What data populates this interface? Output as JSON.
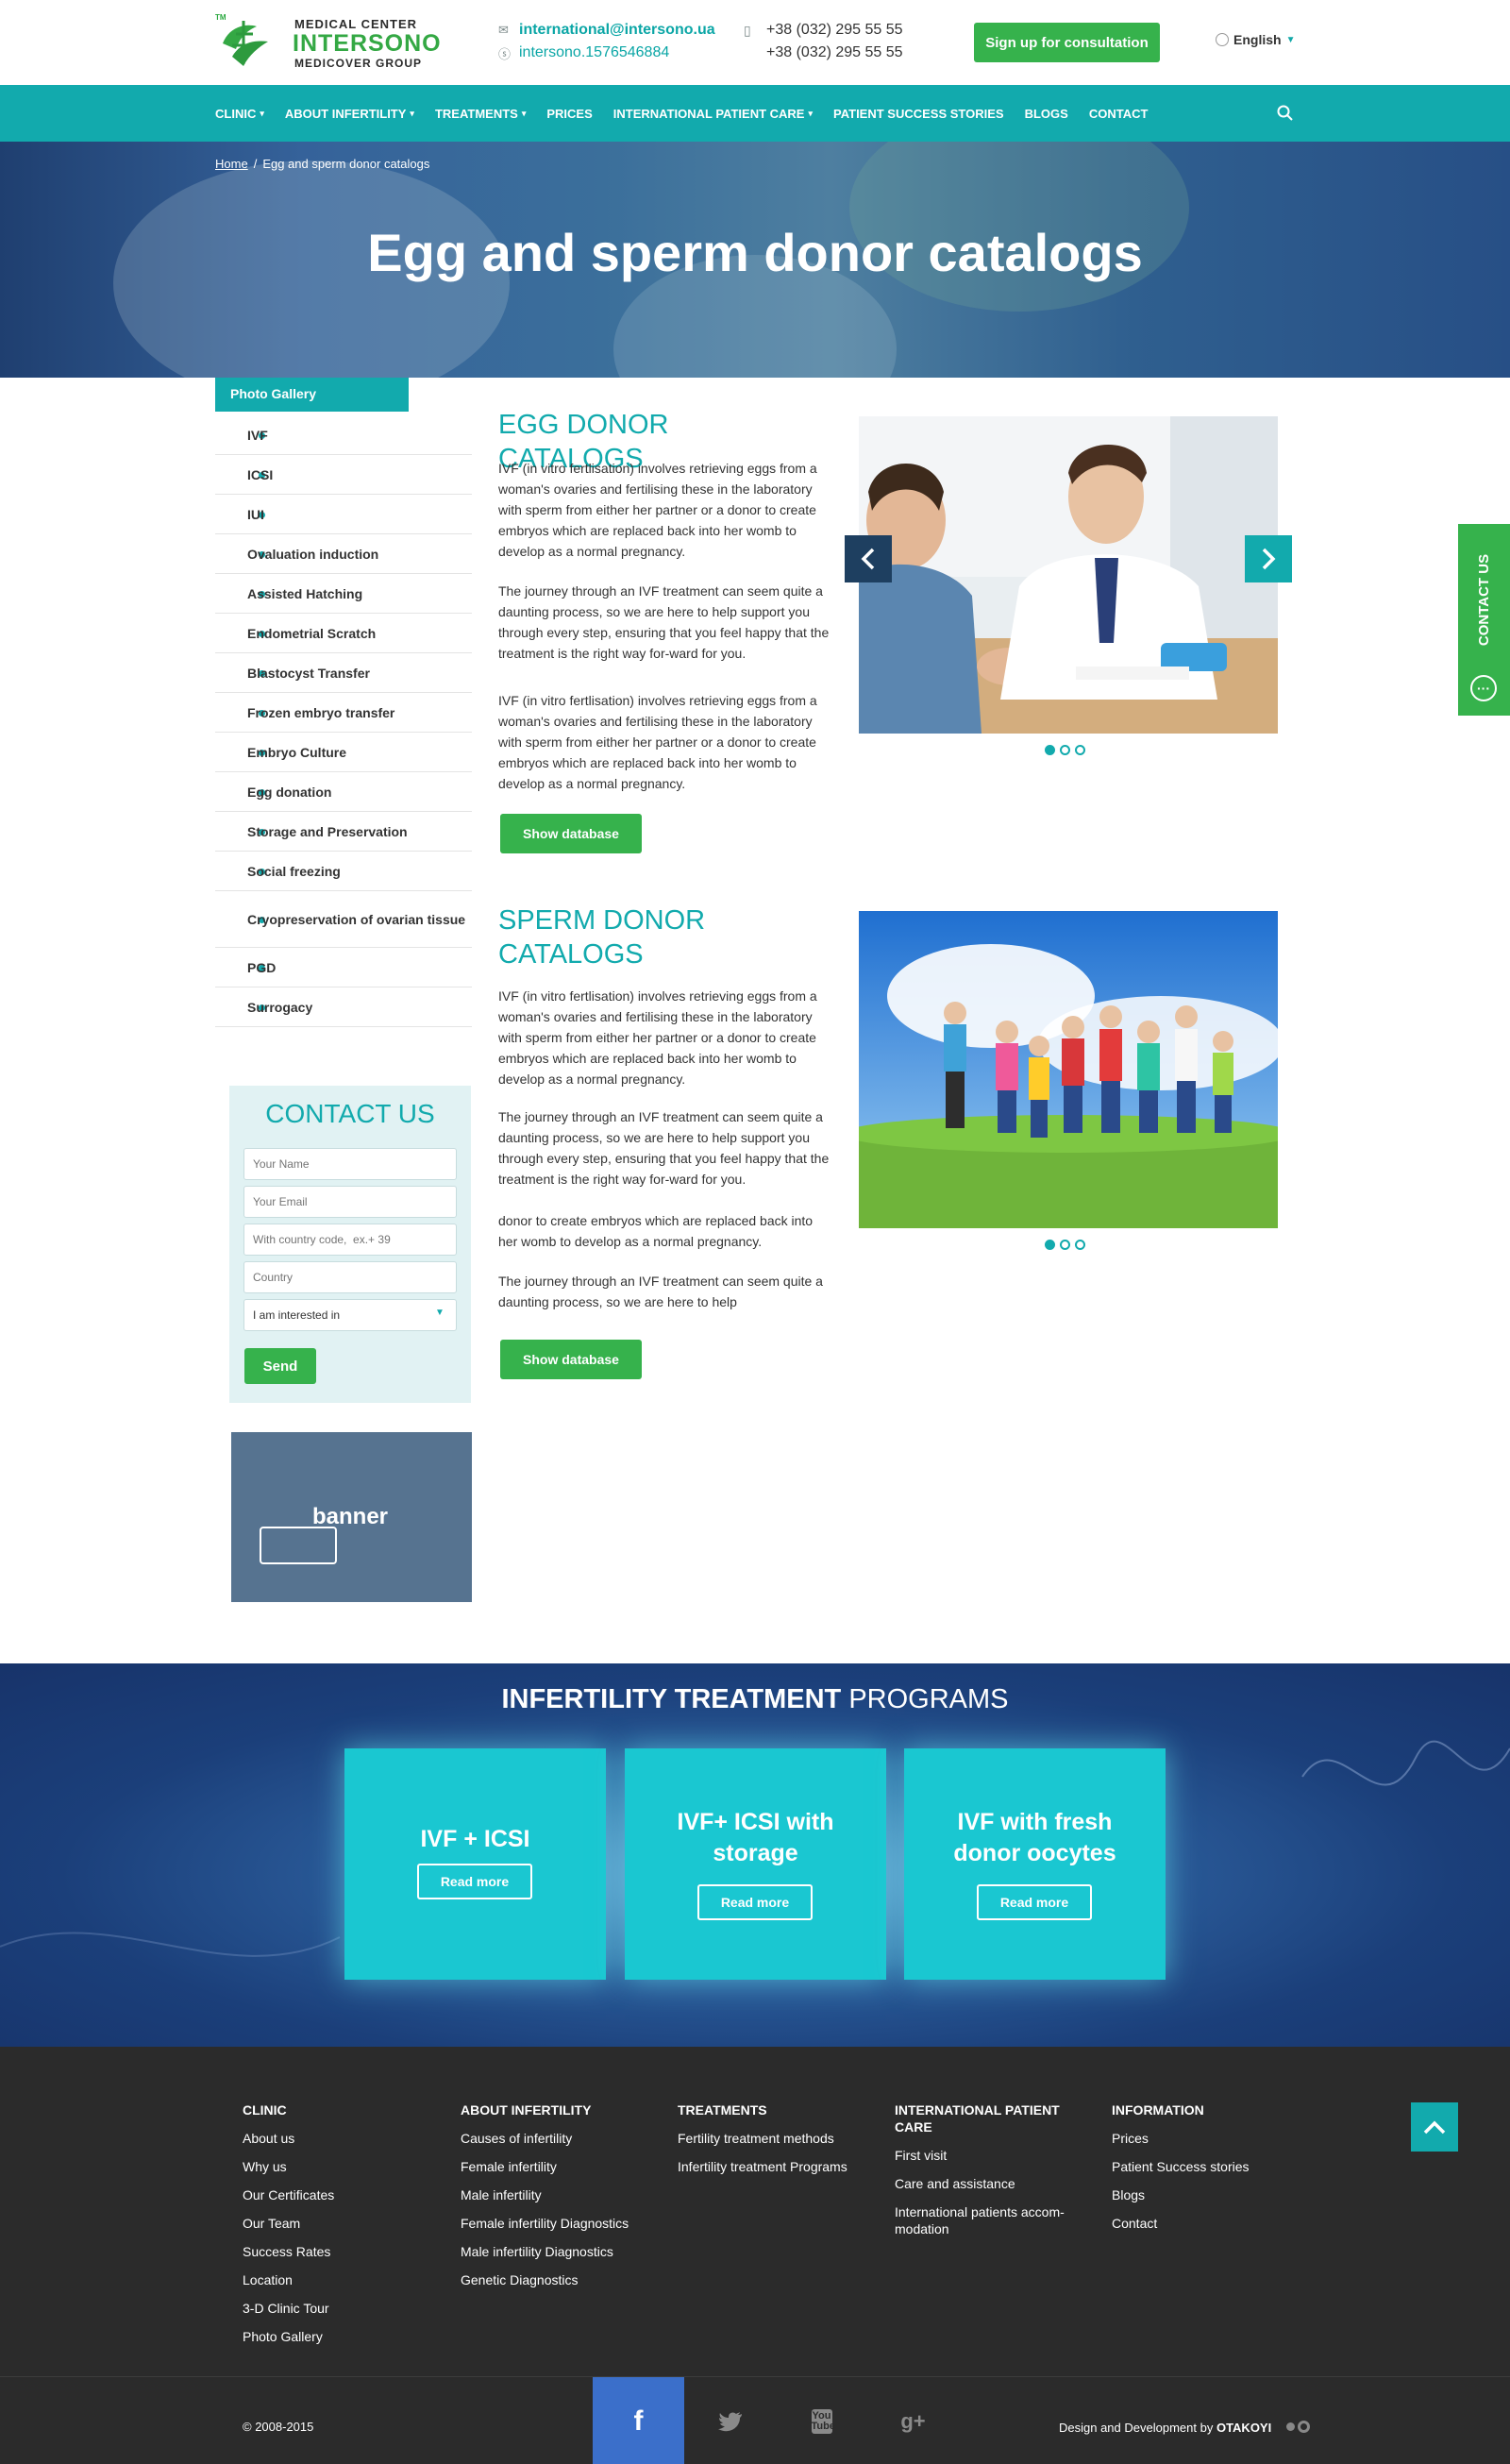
{
  "header": {
    "logo": {
      "tm": "TM",
      "line1": "MEDICAL CENTER",
      "line2": "INTERSONO",
      "line3": "MEDICOVER GROUP"
    },
    "email": "international@intersono.ua",
    "skype": "intersono.1576546884",
    "phone1": "+38 (032) 295 55 55",
    "phone2": "+38 (032) 295 55 55",
    "signup_label": "Sign up for consultation",
    "language": "English"
  },
  "nav": {
    "items": [
      {
        "label": "CLINIC",
        "dropdown": true
      },
      {
        "label": "ABOUT INFERTILITY",
        "dropdown": true
      },
      {
        "label": "TREATMENTS",
        "dropdown": true
      },
      {
        "label": "PRICES",
        "dropdown": false
      },
      {
        "label": "INTERNATIONAL PATIENT CARE",
        "dropdown": true
      },
      {
        "label": "PATIENT SUCCESS STORIES",
        "dropdown": false
      },
      {
        "label": "BLOGS",
        "dropdown": false
      },
      {
        "label": "CONTACT",
        "dropdown": false
      }
    ],
    "search_icon": "search-icon"
  },
  "hero": {
    "breadcrumb_home": "Home",
    "breadcrumb_sep": "/",
    "breadcrumb_current": "Egg and sperm donor catalogs",
    "title": "Egg and sperm donor catalogs"
  },
  "sidebar": {
    "tab": "Photo Gallery",
    "items": [
      "IVF",
      "ICSI",
      "IUI",
      "Ovaluation induction",
      "Assisted Hatching",
      "Endometrial Scratch",
      "Blastocyst Transfer",
      "Frozen embryo transfer",
      "Embryo Culture",
      "Egg donation",
      "Storage and Preservation",
      "Social freezing",
      "Cryopreservation of ovarian tissue",
      "PGD",
      "Surrogacy"
    ]
  },
  "contact_form": {
    "title": "CONTACT US",
    "name_placeholder": "Your Name",
    "email_placeholder": "Your Email",
    "phone_placeholder": "With country code,  ex.+ 39",
    "country_placeholder": "Country",
    "interest_selected": "I am interested in",
    "send_label": "Send"
  },
  "banner": {
    "text": "banner"
  },
  "egg_section": {
    "title": "EGG DONOR CATALOGS",
    "p1": "IVF (in vitro fertlisation) involves retrieving eggs from a woman's ovaries and fertilising these in the laboratory with sperm from either her partner or a donor to create embryos which are replaced back into her womb to develop as a normal pregnancy.",
    "p2": "The journey through an IVF treatment can seem quite a daunting process, so we are here to help support you through every step, ensuring that you feel happy that the treatment is the right way for-ward for you.",
    "p3": "IVF (in vitro fertlisation) involves retrieving eggs from a woman's ovaries and fertilising these in the laboratory with sperm from either her partner or a donor to create embryos which are replaced back into her womb to develop as a normal pregnancy.",
    "button": "Show database"
  },
  "sperm_section": {
    "title": "SPERM DONOR CATALOGS",
    "p1": "IVF (in vitro fertlisation) involves retrieving eggs from a woman's ovaries and fertilising these in the laboratory with sperm from either her partner or a donor to create embryos which are replaced back into her womb to develop as a normal pregnancy.",
    "p2": "The journey through an IVF treatment can seem quite a daunting process, so we are here to help support you through every step, ensuring that you feel happy that the treatment is the right way for-ward for you.",
    "p3": "donor to create embryos which are replaced back into her womb to develop as a normal pregnancy.",
    "p4": "The journey through an IVF treatment can seem quite a daunting process, so we are here to help",
    "button": "Show database"
  },
  "side_contact": {
    "label": "CONTACT US"
  },
  "programs": {
    "title_bold": "INFERTILITY TREATMENT",
    "title_rest": "PROGRAMS",
    "cards": [
      {
        "title": "IVF + ICSI",
        "button": "Read more"
      },
      {
        "title": "IVF+ ICSI with storage",
        "button": "Read more"
      },
      {
        "title": "IVF with fresh donor oocytes",
        "button": "Read more"
      }
    ]
  },
  "footer": {
    "columns": [
      {
        "heading": "CLINIC",
        "links": [
          "About us",
          "Why us",
          "Our Certificates",
          "Our Team",
          "Success Rates",
          "Location",
          "3-D Clinic Tour",
          "Photo Gallery"
        ]
      },
      {
        "heading": "ABOUT INFERTILITY",
        "links": [
          "Causes of infertility",
          "Female infertility",
          "Male infertility",
          "Female infertility Diagnostics",
          "Male infertility Diagnostics",
          "Genetic Diagnostics"
        ]
      },
      {
        "heading": "TREATMENTS",
        "links": [
          "Fertility treatment methods",
          "Infertility treatment Programs"
        ]
      },
      {
        "heading": "INTERNATIONAL PATIENT CARE",
        "links": [
          "First visit",
          "Care and assistance",
          "International patients accom-modation"
        ]
      },
      {
        "heading": "INFORMATION",
        "links": [
          "Prices",
          "Patient Success stories",
          "Blogs",
          "Contact"
        ]
      }
    ],
    "copyright": "© 2008-2015",
    "social": [
      "f",
      "twitter-icon",
      "youtube-icon",
      "g+"
    ],
    "social_text": {
      "youtube": "You Tube",
      "gplus": "g+"
    },
    "design_prefix": "Design and Development by",
    "design_brand": "OTAKOYI"
  },
  "colors": {
    "teal": "#12aaad",
    "green": "#36b24c",
    "dark": "#2b2b2b",
    "facebook": "#3b6fca"
  }
}
